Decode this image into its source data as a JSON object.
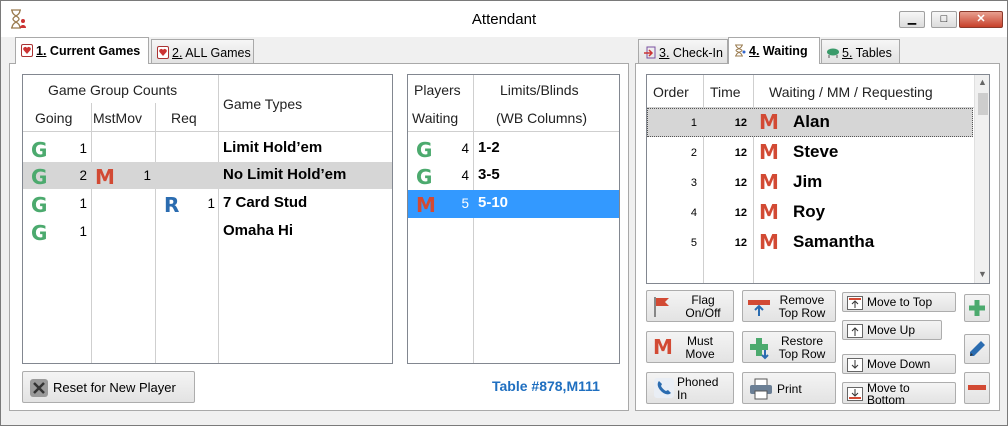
{
  "window": {
    "title": "Attendant"
  },
  "left_tabs": [
    {
      "num": "1.",
      "label": " Current Games"
    },
    {
      "num": "2.",
      "label": " ALL Games"
    }
  ],
  "right_tabs": [
    {
      "num": "3.",
      "label": " Check-In"
    },
    {
      "num": "4.",
      "label": " Waiting"
    },
    {
      "num": "5.",
      "label": " Tables"
    }
  ],
  "games_grid": {
    "group_header": "Game Group Counts",
    "col_going": "Going",
    "col_mstmov": "MstMov",
    "col_req": "Req",
    "col_types": "Game Types",
    "rows": [
      {
        "going_icon": "G",
        "going": "1",
        "mst_icon": "",
        "mst": "",
        "req_icon": "",
        "req": "",
        "type": "Limit Hold’em"
      },
      {
        "going_icon": "G",
        "going": "2",
        "mst_icon": "M",
        "mst": "1",
        "req_icon": "",
        "req": "",
        "type": "No Limit Hold’em"
      },
      {
        "going_icon": "G",
        "going": "1",
        "mst_icon": "",
        "mst": "",
        "req_icon": "R",
        "req": "1",
        "type": "7 Card Stud"
      },
      {
        "going_icon": "G",
        "going": "1",
        "mst_icon": "",
        "mst": "",
        "req_icon": "",
        "req": "",
        "type": "Omaha Hi"
      }
    ]
  },
  "limits_grid": {
    "col_players_1": "Players",
    "col_players_2": "Waiting",
    "col_limits_1": "Limits/Blinds",
    "col_limits_2": "(WB Columns)",
    "rows": [
      {
        "icon": "G",
        "count": "4",
        "limit": "1-2"
      },
      {
        "icon": "G",
        "count": "4",
        "limit": "3-5"
      },
      {
        "icon": "M",
        "count": "5",
        "limit": "5-10"
      }
    ]
  },
  "reset_button": "Reset for New Player",
  "table_info": "Table #878,M111",
  "waiting_grid": {
    "col_order": "Order",
    "col_time": "Time",
    "col_name": "Waiting / MM / Requesting",
    "rows": [
      {
        "order": "1",
        "time": "12",
        "icon": "M",
        "name": "Alan"
      },
      {
        "order": "2",
        "time": "12",
        "icon": "M",
        "name": "Steve"
      },
      {
        "order": "3",
        "time": "12",
        "icon": "M",
        "name": "Jim"
      },
      {
        "order": "4",
        "time": "12",
        "icon": "M",
        "name": "Roy"
      },
      {
        "order": "5",
        "time": "12",
        "icon": "M",
        "name": "Samantha"
      }
    ]
  },
  "actions": {
    "flag": [
      "Flag",
      "On/Off"
    ],
    "must_move": [
      "Must",
      "Move"
    ],
    "phoned": [
      "Phoned",
      "In"
    ],
    "remove": [
      "Remove",
      "Top Row"
    ],
    "restore": [
      "Restore",
      "Top Row"
    ],
    "print": "Print",
    "move_top": "Move to Top",
    "move_up": "Move Up",
    "move_down": "Move Down",
    "move_bottom": [
      "Move to",
      "Bottom"
    ]
  },
  "colors": {
    "green": "#4caa6e",
    "red": "#d24a34",
    "blue_select": "#3399ff",
    "link": "#1f6fc0"
  }
}
